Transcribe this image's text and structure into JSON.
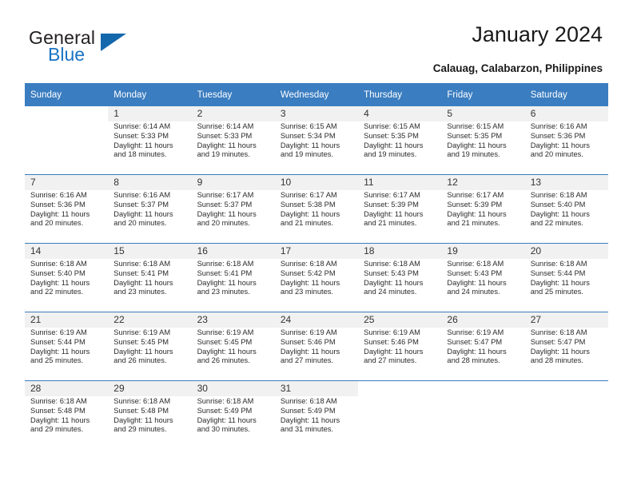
{
  "brand": {
    "name_part1": "General",
    "name_part2": "Blue",
    "flag_icon": "triangle-flag-icon",
    "accent_color": "#1567ac"
  },
  "header": {
    "title": "January 2024",
    "subtitle": "Calauag, Calabarzon, Philippines"
  },
  "calendar": {
    "header_color": "#3a7dc0",
    "daynum_bg": "#f1f1f1",
    "weekdays": [
      "Sunday",
      "Monday",
      "Tuesday",
      "Wednesday",
      "Thursday",
      "Friday",
      "Saturday"
    ],
    "weeks": [
      [
        {
          "day": ""
        },
        {
          "day": "1",
          "sunrise": "Sunrise: 6:14 AM",
          "sunset": "Sunset: 5:33 PM",
          "daylight1": "Daylight: 11 hours",
          "daylight2": "and 18 minutes."
        },
        {
          "day": "2",
          "sunrise": "Sunrise: 6:14 AM",
          "sunset": "Sunset: 5:33 PM",
          "daylight1": "Daylight: 11 hours",
          "daylight2": "and 19 minutes."
        },
        {
          "day": "3",
          "sunrise": "Sunrise: 6:15 AM",
          "sunset": "Sunset: 5:34 PM",
          "daylight1": "Daylight: 11 hours",
          "daylight2": "and 19 minutes."
        },
        {
          "day": "4",
          "sunrise": "Sunrise: 6:15 AM",
          "sunset": "Sunset: 5:35 PM",
          "daylight1": "Daylight: 11 hours",
          "daylight2": "and 19 minutes."
        },
        {
          "day": "5",
          "sunrise": "Sunrise: 6:15 AM",
          "sunset": "Sunset: 5:35 PM",
          "daylight1": "Daylight: 11 hours",
          "daylight2": "and 19 minutes."
        },
        {
          "day": "6",
          "sunrise": "Sunrise: 6:16 AM",
          "sunset": "Sunset: 5:36 PM",
          "daylight1": "Daylight: 11 hours",
          "daylight2": "and 20 minutes."
        }
      ],
      [
        {
          "day": "7",
          "sunrise": "Sunrise: 6:16 AM",
          "sunset": "Sunset: 5:36 PM",
          "daylight1": "Daylight: 11 hours",
          "daylight2": "and 20 minutes."
        },
        {
          "day": "8",
          "sunrise": "Sunrise: 6:16 AM",
          "sunset": "Sunset: 5:37 PM",
          "daylight1": "Daylight: 11 hours",
          "daylight2": "and 20 minutes."
        },
        {
          "day": "9",
          "sunrise": "Sunrise: 6:17 AM",
          "sunset": "Sunset: 5:37 PM",
          "daylight1": "Daylight: 11 hours",
          "daylight2": "and 20 minutes."
        },
        {
          "day": "10",
          "sunrise": "Sunrise: 6:17 AM",
          "sunset": "Sunset: 5:38 PM",
          "daylight1": "Daylight: 11 hours",
          "daylight2": "and 21 minutes."
        },
        {
          "day": "11",
          "sunrise": "Sunrise: 6:17 AM",
          "sunset": "Sunset: 5:39 PM",
          "daylight1": "Daylight: 11 hours",
          "daylight2": "and 21 minutes."
        },
        {
          "day": "12",
          "sunrise": "Sunrise: 6:17 AM",
          "sunset": "Sunset: 5:39 PM",
          "daylight1": "Daylight: 11 hours",
          "daylight2": "and 21 minutes."
        },
        {
          "day": "13",
          "sunrise": "Sunrise: 6:18 AM",
          "sunset": "Sunset: 5:40 PM",
          "daylight1": "Daylight: 11 hours",
          "daylight2": "and 22 minutes."
        }
      ],
      [
        {
          "day": "14",
          "sunrise": "Sunrise: 6:18 AM",
          "sunset": "Sunset: 5:40 PM",
          "daylight1": "Daylight: 11 hours",
          "daylight2": "and 22 minutes."
        },
        {
          "day": "15",
          "sunrise": "Sunrise: 6:18 AM",
          "sunset": "Sunset: 5:41 PM",
          "daylight1": "Daylight: 11 hours",
          "daylight2": "and 23 minutes."
        },
        {
          "day": "16",
          "sunrise": "Sunrise: 6:18 AM",
          "sunset": "Sunset: 5:41 PM",
          "daylight1": "Daylight: 11 hours",
          "daylight2": "and 23 minutes."
        },
        {
          "day": "17",
          "sunrise": "Sunrise: 6:18 AM",
          "sunset": "Sunset: 5:42 PM",
          "daylight1": "Daylight: 11 hours",
          "daylight2": "and 23 minutes."
        },
        {
          "day": "18",
          "sunrise": "Sunrise: 6:18 AM",
          "sunset": "Sunset: 5:43 PM",
          "daylight1": "Daylight: 11 hours",
          "daylight2": "and 24 minutes."
        },
        {
          "day": "19",
          "sunrise": "Sunrise: 6:18 AM",
          "sunset": "Sunset: 5:43 PM",
          "daylight1": "Daylight: 11 hours",
          "daylight2": "and 24 minutes."
        },
        {
          "day": "20",
          "sunrise": "Sunrise: 6:18 AM",
          "sunset": "Sunset: 5:44 PM",
          "daylight1": "Daylight: 11 hours",
          "daylight2": "and 25 minutes."
        }
      ],
      [
        {
          "day": "21",
          "sunrise": "Sunrise: 6:19 AM",
          "sunset": "Sunset: 5:44 PM",
          "daylight1": "Daylight: 11 hours",
          "daylight2": "and 25 minutes."
        },
        {
          "day": "22",
          "sunrise": "Sunrise: 6:19 AM",
          "sunset": "Sunset: 5:45 PM",
          "daylight1": "Daylight: 11 hours",
          "daylight2": "and 26 minutes."
        },
        {
          "day": "23",
          "sunrise": "Sunrise: 6:19 AM",
          "sunset": "Sunset: 5:45 PM",
          "daylight1": "Daylight: 11 hours",
          "daylight2": "and 26 minutes."
        },
        {
          "day": "24",
          "sunrise": "Sunrise: 6:19 AM",
          "sunset": "Sunset: 5:46 PM",
          "daylight1": "Daylight: 11 hours",
          "daylight2": "and 27 minutes."
        },
        {
          "day": "25",
          "sunrise": "Sunrise: 6:19 AM",
          "sunset": "Sunset: 5:46 PM",
          "daylight1": "Daylight: 11 hours",
          "daylight2": "and 27 minutes."
        },
        {
          "day": "26",
          "sunrise": "Sunrise: 6:19 AM",
          "sunset": "Sunset: 5:47 PM",
          "daylight1": "Daylight: 11 hours",
          "daylight2": "and 28 minutes."
        },
        {
          "day": "27",
          "sunrise": "Sunrise: 6:18 AM",
          "sunset": "Sunset: 5:47 PM",
          "daylight1": "Daylight: 11 hours",
          "daylight2": "and 28 minutes."
        }
      ],
      [
        {
          "day": "28",
          "sunrise": "Sunrise: 6:18 AM",
          "sunset": "Sunset: 5:48 PM",
          "daylight1": "Daylight: 11 hours",
          "daylight2": "and 29 minutes."
        },
        {
          "day": "29",
          "sunrise": "Sunrise: 6:18 AM",
          "sunset": "Sunset: 5:48 PM",
          "daylight1": "Daylight: 11 hours",
          "daylight2": "and 29 minutes."
        },
        {
          "day": "30",
          "sunrise": "Sunrise: 6:18 AM",
          "sunset": "Sunset: 5:49 PM",
          "daylight1": "Daylight: 11 hours",
          "daylight2": "and 30 minutes."
        },
        {
          "day": "31",
          "sunrise": "Sunrise: 6:18 AM",
          "sunset": "Sunset: 5:49 PM",
          "daylight1": "Daylight: 11 hours",
          "daylight2": "and 31 minutes."
        },
        {
          "day": ""
        },
        {
          "day": ""
        },
        {
          "day": ""
        }
      ]
    ]
  }
}
